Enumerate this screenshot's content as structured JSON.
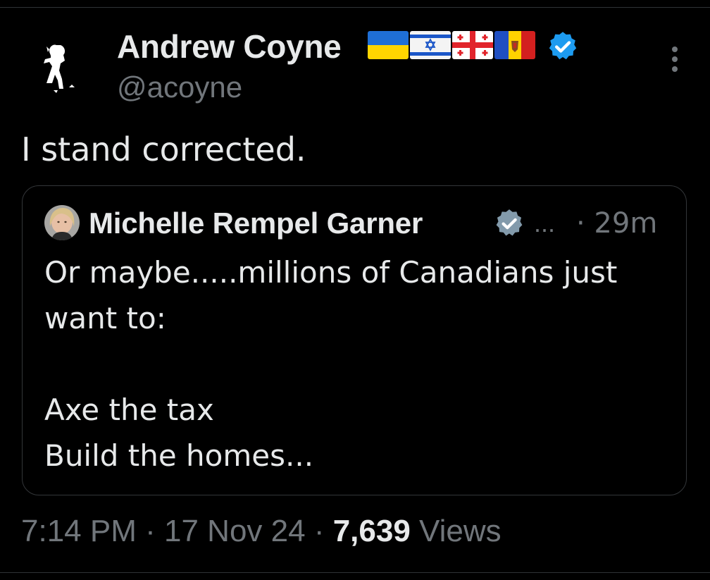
{
  "tweet": {
    "author_name": "Andrew Coyne",
    "author_handle": "@acoyne",
    "flags": [
      "ukraine-flag",
      "israel-flag",
      "georgia-flag",
      "moldova-flag"
    ],
    "verified": true,
    "text": "I stand corrected.",
    "time": "7:14 PM",
    "date": "17 Nov 24",
    "views_count": "7,639",
    "views_label": "Views",
    "separator": "·"
  },
  "quote": {
    "author_name": "Michelle Rempel Garner",
    "verified": true,
    "ellipsis": "...",
    "time": "· 29m",
    "text": "Or maybe.....millions of Canadians just\nwant to:\n\nAxe the tax\nBuild the homes..."
  },
  "icons": {
    "more": "more-vertical-icon",
    "verified": "verified-badge-icon"
  },
  "colors": {
    "background": "#000000",
    "text_primary": "#e7e9ea",
    "text_secondary": "#71767b",
    "border": "#333639",
    "verified_blue": "#1d9bf0",
    "verified_gray": "#829aab"
  }
}
